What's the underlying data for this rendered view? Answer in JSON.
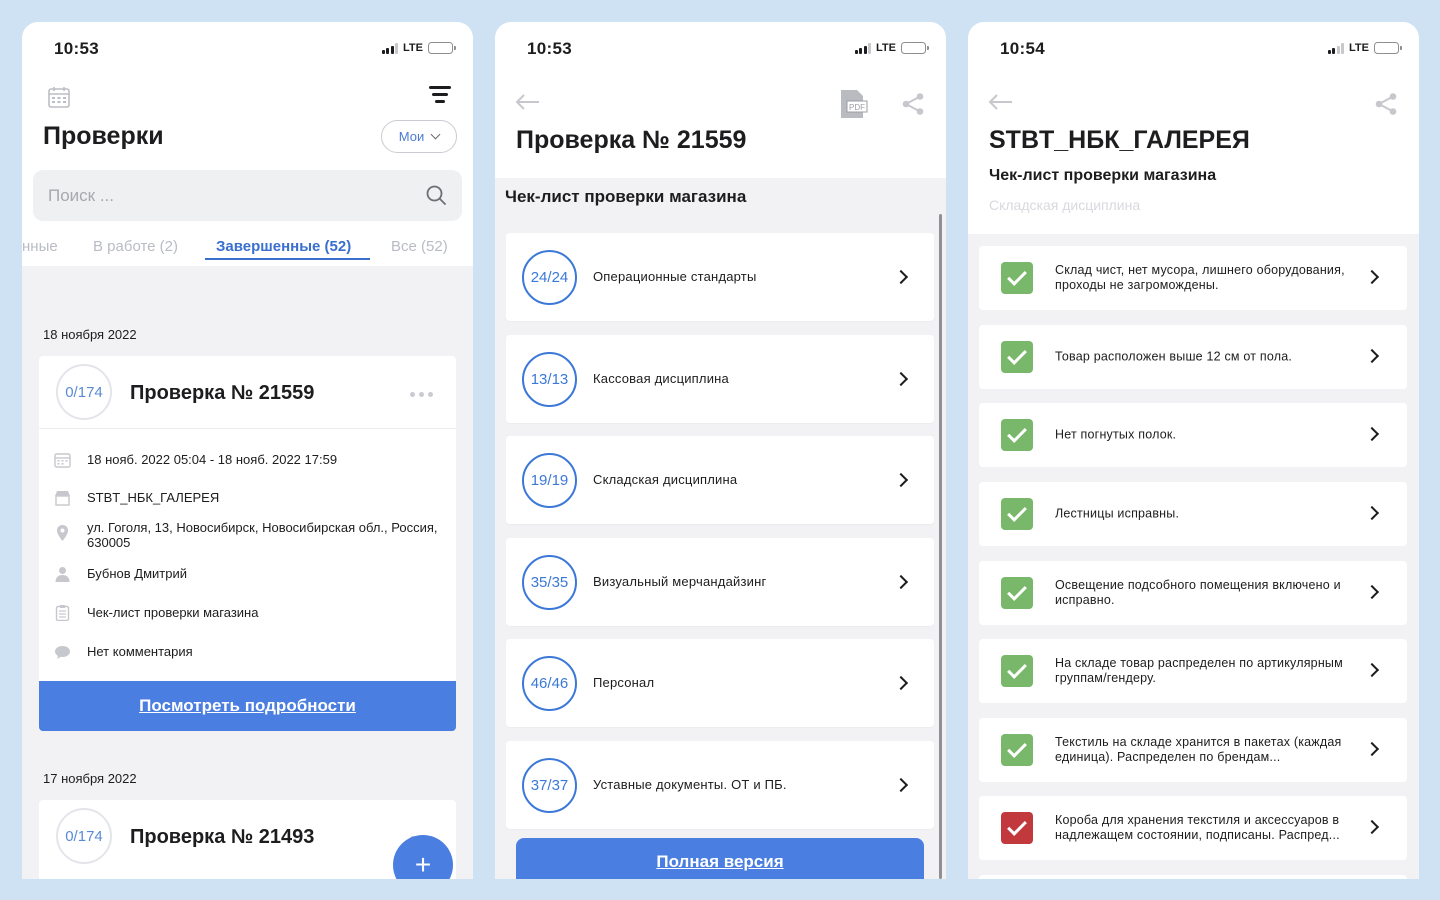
{
  "colors": {
    "background": "#cfe2f4",
    "accent": "#4a7ee0",
    "ok": "#79b86b",
    "bad": "#c2393d"
  },
  "status_bars": [
    {
      "time": "10:53",
      "network": "LTE"
    },
    {
      "time": "10:53",
      "network": "LTE"
    },
    {
      "time": "10:54",
      "network": "LTE"
    }
  ],
  "screen1": {
    "title": "Проверки",
    "filter_button": "Мои",
    "search_placeholder": "Поиск ...",
    "tabs": [
      "нные",
      "В работе (2)",
      "Завершенные (52)",
      "Все (52)"
    ],
    "active_tab": "Завершенные (52)",
    "groups": [
      {
        "date": "18 ноября 2022",
        "card": {
          "score": "0/174",
          "title": "Проверка № 21559",
          "period": "18 нояб. 2022 05:04 - 18 нояб. 2022 17:59",
          "store": "STBT_НБК_ГАЛЕРЕЯ",
          "address": "ул. Гоголя, 13, Новосибирск, Новосибирская обл., Россия, 630005",
          "inspector": "Бубнов Дмитрий",
          "checklist": "Чек-лист проверки магазина",
          "comment": "Нет комментария",
          "details_button": "Посмотреть подробности"
        }
      },
      {
        "date": "17 ноября 2022",
        "card": {
          "score": "0/174",
          "title": "Проверка № 21493"
        }
      }
    ],
    "fab_label": "+"
  },
  "screen2": {
    "title": "Проверка № 21559",
    "subtitle": "Чек-лист проверки магазина",
    "sections": [
      {
        "score": "24/24",
        "label": "Операционные стандарты"
      },
      {
        "score": "13/13",
        "label": "Кассовая дисциплина"
      },
      {
        "score": "19/19",
        "label": "Складская дисциплина"
      },
      {
        "score": "35/35",
        "label": "Визуальный мерчандайзинг"
      },
      {
        "score": "46/46",
        "label": "Персонал"
      },
      {
        "score": "37/37",
        "label": "Уставные документы. ОТ и ПБ."
      }
    ],
    "full_version_button": "Полная версия"
  },
  "screen3": {
    "title": "STBT_НБК_ГАЛЕРЕЯ",
    "subtitle": "Чек-лист проверки магазина",
    "section": "Складская дисциплина",
    "items": [
      {
        "text": "Склад чист, нет мусора, лишнего оборудования, проходы не загромождены.",
        "status": "ok"
      },
      {
        "text": "Товар расположен выше 12 см от пола.",
        "status": "ok"
      },
      {
        "text": "Нет погнутых полок.",
        "status": "ok"
      },
      {
        "text": "Лестницы исправны.",
        "status": "ok"
      },
      {
        "text": "Освещение подсобного помещения включено и исправно.",
        "status": "ok"
      },
      {
        "text": "На складе товар распределен по артикулярным группам/гендеру.",
        "status": "ok"
      },
      {
        "text": "Текстиль на складе хранится в пакетах (каждая единица). Распределен по брендам...",
        "status": "ok"
      },
      {
        "text": "Короба для хранения текстиля и аксессуаров в надлежащем состоянии, подписаны. Распред...",
        "status": "bad"
      }
    ]
  }
}
